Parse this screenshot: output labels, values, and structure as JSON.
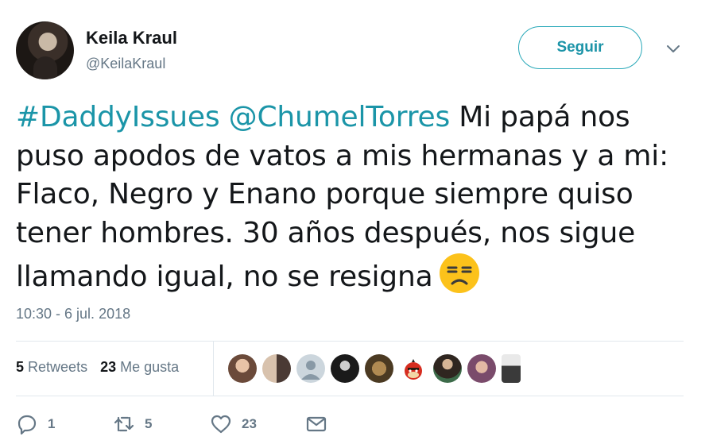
{
  "author": {
    "display_name": "Keila Kraul",
    "handle": "@KeilaKraul"
  },
  "follow_button_label": "Seguir",
  "tweet": {
    "hashtag": "#DaddyIssues",
    "mention": "@ChumelTorres",
    "line1_rest": " Mi papá nos",
    "line2": "puso apodos de vatos a mis hermanas y a mi:",
    "line3": "Flaco, Negro y Enano porque siempre quiso",
    "line4": "tener hombres. 30 años después, nos sigue",
    "line5": "llamando igual, no se resigna",
    "emoji": "unamused-face-emoji"
  },
  "timestamp": "10:30 - 6 jul. 2018",
  "stats": {
    "retweets_count": "5",
    "retweets_label": "Retweets",
    "likes_count": "23",
    "likes_label": "Me gusta"
  },
  "actions": {
    "reply_count": "1",
    "retweet_count": "5",
    "like_count": "23"
  },
  "icons": {
    "chevron": "chevron-down-icon",
    "reply": "reply-icon",
    "retweet": "retweet-icon",
    "like": "heart-icon",
    "dm": "envelope-icon"
  },
  "colors": {
    "accent": "#1b95a8",
    "muted": "#657786",
    "text": "#14171a",
    "divider": "#e1e8ed"
  }
}
